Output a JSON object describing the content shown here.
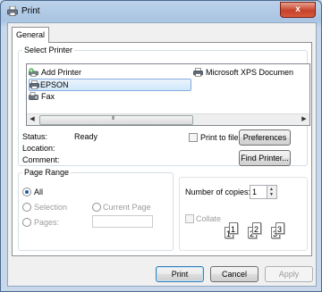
{
  "window": {
    "title": "Print",
    "close_symbol": "x"
  },
  "tabs": [
    {
      "label": "General"
    }
  ],
  "select_printer": {
    "title": "Select Printer",
    "printers": [
      {
        "label": "Add Printer",
        "icon": "add-printer-icon"
      },
      {
        "label": "EPSON",
        "icon": "printer-icon",
        "selected": true
      },
      {
        "label": "Fax",
        "icon": "fax-icon"
      },
      {
        "label": "Microsoft XPS Documen",
        "icon": "printer-icon"
      }
    ],
    "scroll_left": "◀",
    "scroll_right": "▶",
    "scroll_grip": "III",
    "status_label": "Status:",
    "status_value": "Ready",
    "location_label": "Location:",
    "comment_label": "Comment:",
    "print_to_file": "Print to file",
    "preferences": "Preferences",
    "find_printer": "Find Printer..."
  },
  "page_range": {
    "title": "Page Range",
    "all": "All",
    "selection": "Selection",
    "current_page": "Current Page",
    "pages": "Pages:"
  },
  "copies": {
    "label": "Number of copies:",
    "value": "1",
    "up_arrow": "▲",
    "down_arrow": "▼",
    "collate": "Collate",
    "page_numbers": [
      "1",
      "1",
      "2",
      "2",
      "3",
      "3"
    ]
  },
  "buttons": {
    "print": "Print",
    "cancel": "Cancel",
    "apply": "Apply"
  }
}
